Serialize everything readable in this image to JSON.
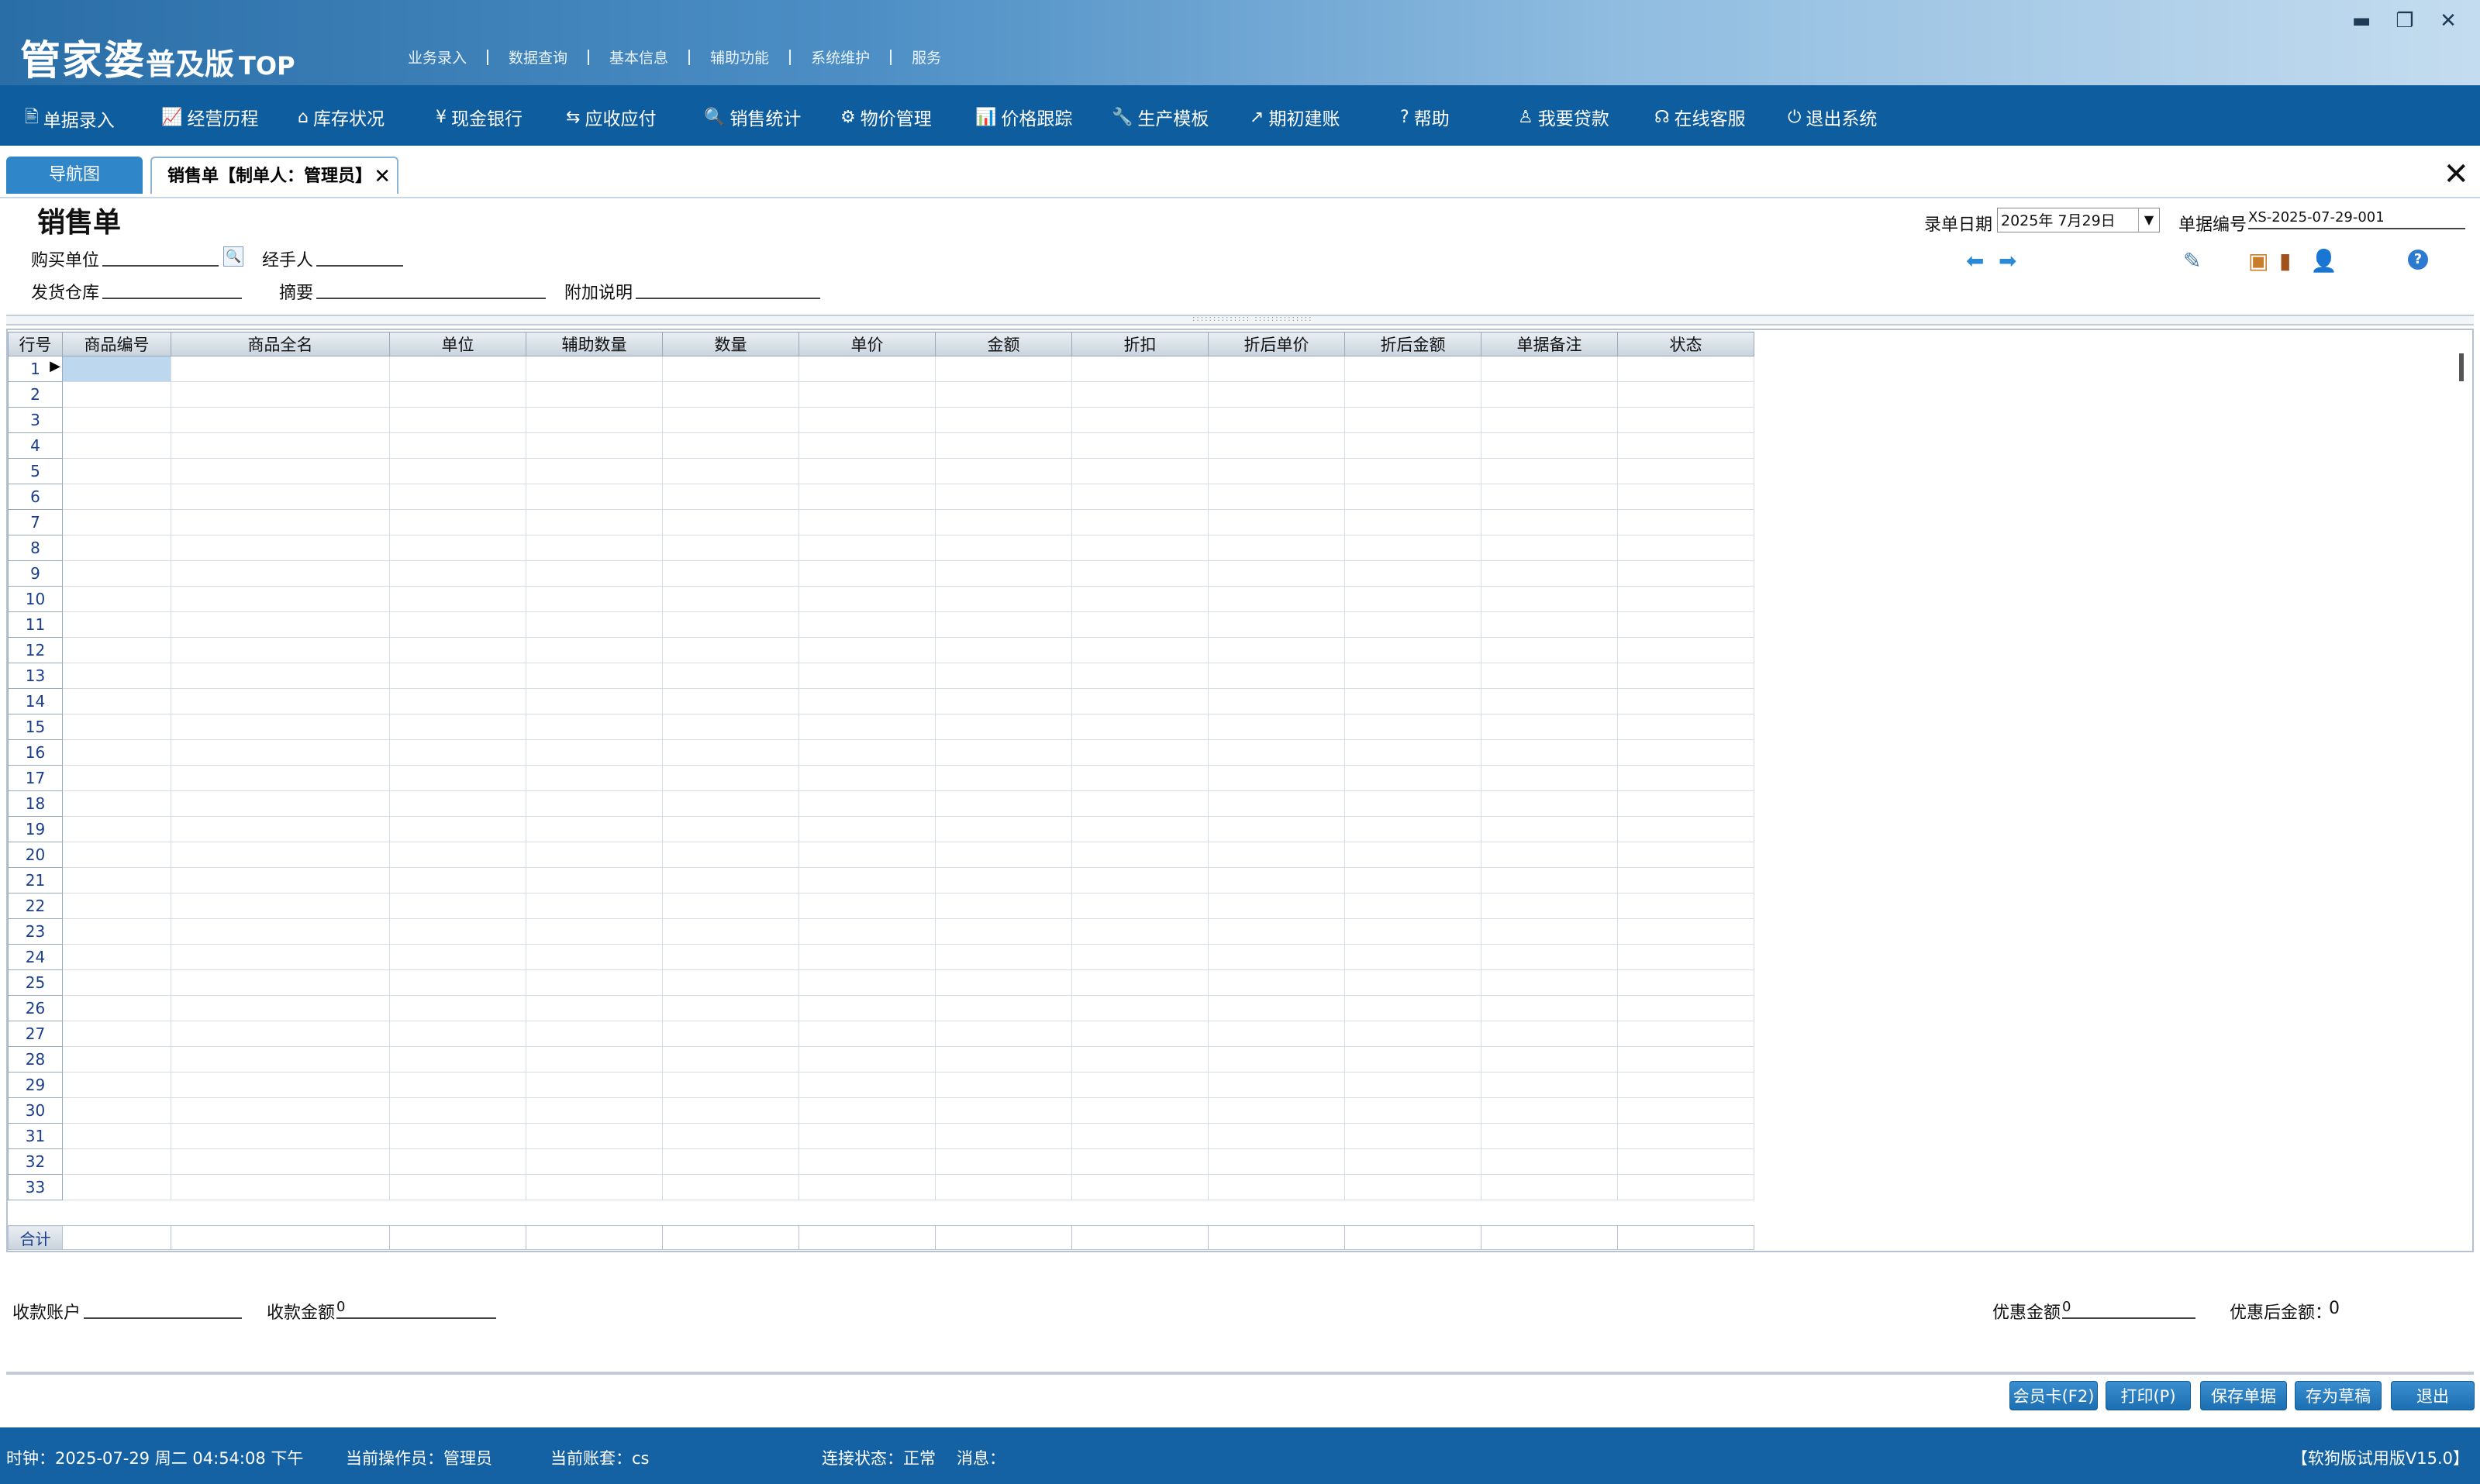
{
  "app": {
    "logo_main": "管家婆",
    "logo_edition": "普及版",
    "logo_suffix": "TOP"
  },
  "top_menu": [
    "业务录入",
    "数据查询",
    "基本信息",
    "辅助功能",
    "系统维护",
    "服务"
  ],
  "window_controls": {
    "minimize": "▬",
    "maximize": "❐",
    "close": "✕"
  },
  "nav": [
    {
      "label": "单据录入",
      "icon": "document-icon",
      "glyph": "🖹"
    },
    {
      "label": "经营历程",
      "icon": "chart-line-icon",
      "glyph": "📈"
    },
    {
      "label": "库存状况",
      "icon": "home-icon",
      "glyph": "⌂"
    },
    {
      "label": "现金银行",
      "icon": "yen-icon",
      "glyph": "¥"
    },
    {
      "label": "应收应付",
      "icon": "exchange-icon",
      "glyph": "⇆"
    },
    {
      "label": "销售统计",
      "icon": "search-icon",
      "glyph": "🔍"
    },
    {
      "label": "物价管理",
      "icon": "gear-icon",
      "glyph": "⚙"
    },
    {
      "label": "价格跟踪",
      "icon": "bar-chart-icon",
      "glyph": "📊"
    },
    {
      "label": "生产模板",
      "icon": "wrench-icon",
      "glyph": "🔧"
    },
    {
      "label": "期初建账",
      "icon": "external-link-icon",
      "glyph": "↗"
    },
    {
      "label": "帮助",
      "icon": "question-icon",
      "glyph": "?"
    },
    {
      "label": "我要贷款",
      "icon": "bag-icon",
      "glyph": "♙"
    },
    {
      "label": "在线客服",
      "icon": "headset-icon",
      "glyph": "☊"
    },
    {
      "label": "退出系统",
      "icon": "power-icon",
      "glyph": "⏻"
    }
  ],
  "tabs": {
    "nav_tab": "导航图",
    "sales_tab": "销售单【制单人：管理员】",
    "close_glyph": "✕"
  },
  "form": {
    "title": "销售单",
    "buyer_label": "购买单位",
    "handler_label": "经手人",
    "warehouse_label": "发货仓库",
    "summary_label": "摘要",
    "note_label": "附加说明",
    "date_label": "录单日期",
    "date_value": "2025年 7月29日",
    "doc_no_label": "单据编号",
    "doc_no_value": "XS-2025-07-29-001"
  },
  "grid": {
    "columns": [
      "行号",
      "商品编号",
      "商品全名",
      "单位",
      "辅助数量",
      "数量",
      "单价",
      "金额",
      "折扣",
      "折后单价",
      "折后金额",
      "单据备注",
      "状态"
    ],
    "row_numbers": [
      "1",
      "2",
      "3",
      "4",
      "5",
      "6",
      "7",
      "8",
      "9",
      "10",
      "11",
      "12",
      "13",
      "14",
      "15",
      "16",
      "17",
      "18",
      "19",
      "20",
      "21",
      "22",
      "23",
      "24",
      "25",
      "26",
      "27",
      "28",
      "29",
      "30",
      "31",
      "32",
      "33"
    ],
    "total_label": "合计"
  },
  "bottom": {
    "account_label": "收款账户",
    "amount_label": "收款金额",
    "amount_value": "0",
    "discount_label": "优惠金额",
    "discount_value": "0",
    "after_discount_label": "优惠后金额：",
    "after_discount_value": "0"
  },
  "buttons": {
    "member_card": "会员卡(F2)",
    "print": "打印(P)",
    "save": "保存单据",
    "draft": "存为草稿",
    "exit": "退出"
  },
  "status": {
    "clock": "时钟：2025-07-29 周二 04:54:08 下午",
    "operator": "当前操作员：管理员",
    "account_set": "当前账套：cs",
    "connection": "连接状态：正常",
    "message": "消息：",
    "version": "【软狗版试用版V15.0】"
  },
  "colors": {
    "navbar": "#0d5d9f",
    "statusbar": "#1462a4",
    "button": "#1b6fb2",
    "selected_cell": "#bdd7ee"
  }
}
